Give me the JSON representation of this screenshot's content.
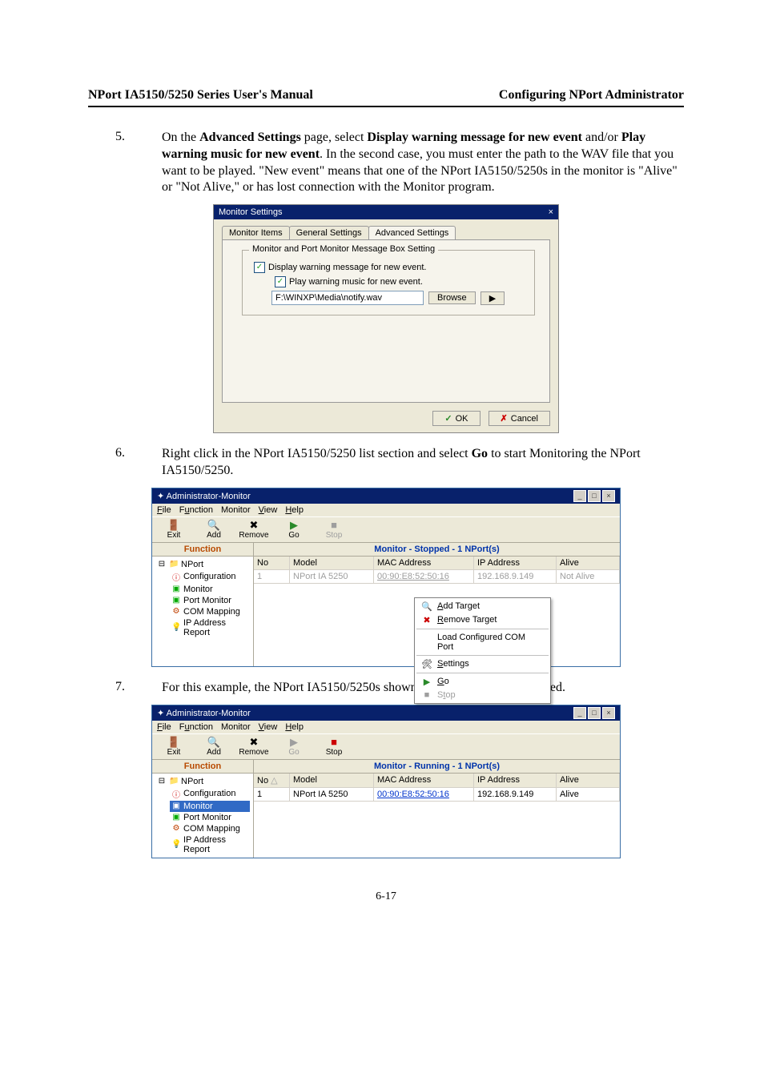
{
  "header": {
    "left": "NPort IA5150/5250 Series User's Manual",
    "right": "Configuring NPort Administrator"
  },
  "step5": {
    "num": "5.",
    "text_pre": "On the ",
    "b1": "Advanced Settings",
    "mid1": " page, select ",
    "b2": "Display warning message for new event",
    "mid2": " and/or ",
    "b3": "Play warning music for new event",
    "tail": ". In the second case, you must enter the path to the WAV file that you want to be played. \"New event\" means that one of the NPort IA5150/5250s in the monitor is \"Alive\" or \"Not Alive,\" or has lost connection with the Monitor program."
  },
  "dlg": {
    "title": "Monitor Settings",
    "close": "×",
    "tabs": {
      "t1": "Monitor Items",
      "t2": "General Settings",
      "t3": "Advanced Settings"
    },
    "group": "Monitor and Port Monitor Message Box Setting",
    "cb1": "Display warning message for new event.",
    "cb2": "Play warning music for new event.",
    "path": "F:\\WINXP\\Media\\notify.wav",
    "browse": "Browse",
    "play": "▶",
    "ok": "OK",
    "cancel": "Cancel"
  },
  "step6": {
    "num": "6.",
    "pre": "Right click in the NPort IA5150/5250 list section and select ",
    "b": "Go",
    "post": " to start Monitoring the NPort IA5150/5250."
  },
  "win": {
    "title": "Administrator-Monitor",
    "menus": {
      "file": "File",
      "func": "Function",
      "mon": "Monitor",
      "view": "View",
      "help": "Help"
    },
    "tools": {
      "exit": "Exit",
      "add": "Add",
      "remove": "Remove",
      "go": "Go",
      "stop": "Stop"
    },
    "func_label": "Function",
    "status_stopped": "Monitor - Stopped - 1 NPort(s)",
    "status_running": "Monitor - Running - 1 NPort(s)",
    "tree": {
      "root": "NPort",
      "items": [
        "Configuration",
        "Monitor",
        "Port Monitor",
        "COM Mapping",
        "IP Address Report"
      ]
    },
    "cols": {
      "no": "No",
      "model": "Model",
      "mac": "MAC Address",
      "ip": "IP Address",
      "alive": "Alive"
    },
    "row": {
      "no": "1",
      "model": "NPort IA 5250",
      "mac": "00:90:E8:52:50:16",
      "ip": "192.168.9.149",
      "alive_na": "Not Alive",
      "alive_a": "Alive"
    },
    "ctx": {
      "add": "Add Target",
      "remove": "Remove Target",
      "load": "Load Configured COM Port",
      "settings": "Settings",
      "go": "Go",
      "stop": "Stop"
    }
  },
  "step7": {
    "num": "7.",
    "text": "For this example, the NPort IA5150/5250s shown in the list will be monitored."
  },
  "pagenum": "6-17"
}
